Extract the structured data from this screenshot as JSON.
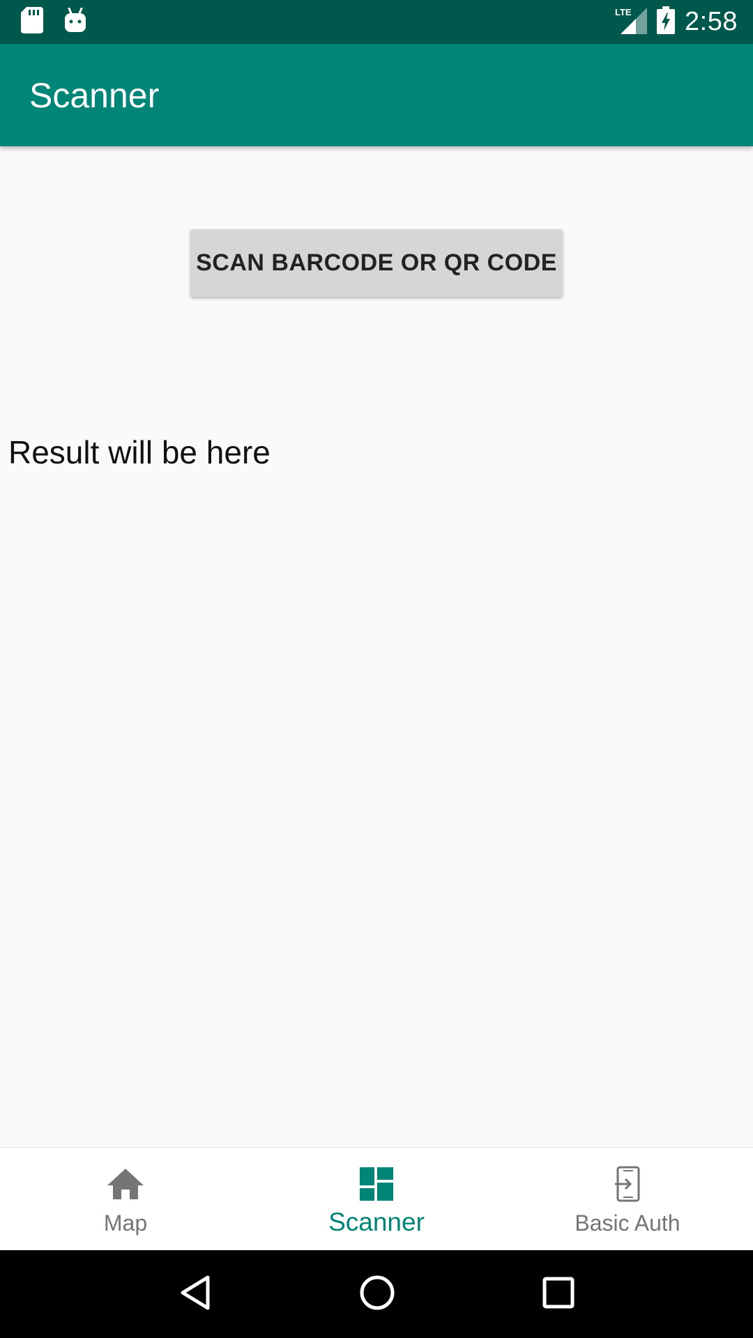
{
  "status_bar": {
    "time": "2:58",
    "network": "LTE",
    "icons": [
      "sd-card-icon",
      "android-icon",
      "lte-signal-icon",
      "battery-charging-icon"
    ]
  },
  "app_bar": {
    "title": "Scanner"
  },
  "main": {
    "scan_button_label": "SCAN BARCODE OR QR CODE",
    "result_text": "Result will be here"
  },
  "bottom_nav": {
    "items": [
      {
        "label": "Map",
        "icon": "home-icon",
        "active": false
      },
      {
        "label": "Scanner",
        "icon": "dashboard-icon",
        "active": true
      },
      {
        "label": "Basic Auth",
        "icon": "phone-login-icon",
        "active": false
      }
    ]
  },
  "system_nav": {
    "icons": [
      "back-icon",
      "home-circle-icon",
      "recents-icon"
    ]
  },
  "colors": {
    "status_bar": "#00574b",
    "primary": "#008577",
    "inactive": "#757575",
    "background": "#fafafa",
    "button": "#d6d6d6"
  }
}
